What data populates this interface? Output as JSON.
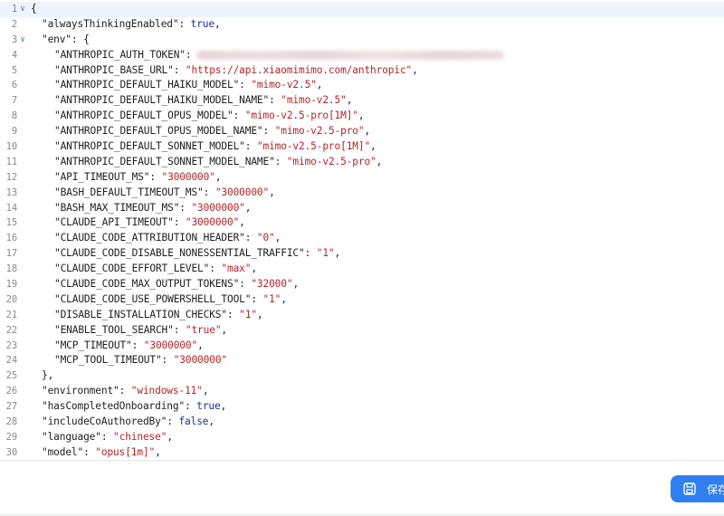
{
  "editor": {
    "lines": [
      {
        "n": "1",
        "fold": "∨",
        "indent": 0,
        "parts": [
          {
            "t": "{",
            "c": "p"
          }
        ]
      },
      {
        "n": "2",
        "fold": "",
        "indent": 1,
        "parts": [
          {
            "t": "\"alwaysThinkingEnabled\"",
            "c": "k"
          },
          {
            "t": ": ",
            "c": "p"
          },
          {
            "t": "true",
            "c": "b"
          },
          {
            "t": ",",
            "c": "p"
          }
        ]
      },
      {
        "n": "3",
        "fold": "∨",
        "indent": 1,
        "parts": [
          {
            "t": "\"env\"",
            "c": "k"
          },
          {
            "t": ": {",
            "c": "p"
          }
        ]
      },
      {
        "n": "4",
        "fold": "",
        "indent": 2,
        "redacted": true,
        "parts": [
          {
            "t": "\"ANTHROPIC_AUTH_TOKEN\"",
            "c": "k"
          },
          {
            "t": ":",
            "c": "p"
          }
        ]
      },
      {
        "n": "5",
        "fold": "",
        "indent": 2,
        "parts": [
          {
            "t": "\"ANTHROPIC_BASE_URL\"",
            "c": "k"
          },
          {
            "t": ": ",
            "c": "p"
          },
          {
            "t": "\"https://api.xiaomimimo.com/anthropic\"",
            "c": "s"
          },
          {
            "t": ",",
            "c": "p"
          }
        ]
      },
      {
        "n": "6",
        "fold": "",
        "indent": 2,
        "parts": [
          {
            "t": "\"ANTHROPIC_DEFAULT_HAIKU_MODEL\"",
            "c": "k"
          },
          {
            "t": ": ",
            "c": "p"
          },
          {
            "t": "\"mimo-v2.5\"",
            "c": "s"
          },
          {
            "t": ",",
            "c": "p"
          }
        ]
      },
      {
        "n": "7",
        "fold": "",
        "indent": 2,
        "parts": [
          {
            "t": "\"ANTHROPIC_DEFAULT_HAIKU_MODEL_NAME\"",
            "c": "k"
          },
          {
            "t": ": ",
            "c": "p"
          },
          {
            "t": "\"mimo-v2.5\"",
            "c": "s"
          },
          {
            "t": ",",
            "c": "p"
          }
        ]
      },
      {
        "n": "8",
        "fold": "",
        "indent": 2,
        "parts": [
          {
            "t": "\"ANTHROPIC_DEFAULT_OPUS_MODEL\"",
            "c": "k"
          },
          {
            "t": ": ",
            "c": "p"
          },
          {
            "t": "\"mimo-v2.5-pro[1M]\"",
            "c": "s"
          },
          {
            "t": ",",
            "c": "p"
          }
        ]
      },
      {
        "n": "9",
        "fold": "",
        "indent": 2,
        "parts": [
          {
            "t": "\"ANTHROPIC_DEFAULT_OPUS_MODEL_NAME\"",
            "c": "k"
          },
          {
            "t": ": ",
            "c": "p"
          },
          {
            "t": "\"mimo-v2.5-pro\"",
            "c": "s"
          },
          {
            "t": ",",
            "c": "p"
          }
        ]
      },
      {
        "n": "10",
        "fold": "",
        "indent": 2,
        "parts": [
          {
            "t": "\"ANTHROPIC_DEFAULT_SONNET_MODEL\"",
            "c": "k"
          },
          {
            "t": ": ",
            "c": "p"
          },
          {
            "t": "\"mimo-v2.5-pro[1M]\"",
            "c": "s"
          },
          {
            "t": ",",
            "c": "p"
          }
        ]
      },
      {
        "n": "11",
        "fold": "",
        "indent": 2,
        "parts": [
          {
            "t": "\"ANTHROPIC_DEFAULT_SONNET_MODEL_NAME\"",
            "c": "k"
          },
          {
            "t": ": ",
            "c": "p"
          },
          {
            "t": "\"mimo-v2.5-pro\"",
            "c": "s"
          },
          {
            "t": ",",
            "c": "p"
          }
        ]
      },
      {
        "n": "12",
        "fold": "",
        "indent": 2,
        "parts": [
          {
            "t": "\"API_TIMEOUT_MS\"",
            "c": "k"
          },
          {
            "t": ": ",
            "c": "p"
          },
          {
            "t": "\"3000000\"",
            "c": "s"
          },
          {
            "t": ",",
            "c": "p"
          }
        ]
      },
      {
        "n": "13",
        "fold": "",
        "indent": 2,
        "parts": [
          {
            "t": "\"BASH_DEFAULT_TIMEOUT_MS\"",
            "c": "k"
          },
          {
            "t": ": ",
            "c": "p"
          },
          {
            "t": "\"3000000\"",
            "c": "s"
          },
          {
            "t": ",",
            "c": "p"
          }
        ]
      },
      {
        "n": "14",
        "fold": "",
        "indent": 2,
        "parts": [
          {
            "t": "\"BASH_MAX_TIMEOUT_MS\"",
            "c": "k"
          },
          {
            "t": ": ",
            "c": "p"
          },
          {
            "t": "\"3000000\"",
            "c": "s"
          },
          {
            "t": ",",
            "c": "p"
          }
        ]
      },
      {
        "n": "15",
        "fold": "",
        "indent": 2,
        "parts": [
          {
            "t": "\"CLAUDE_API_TIMEOUT\"",
            "c": "k"
          },
          {
            "t": ": ",
            "c": "p"
          },
          {
            "t": "\"3000000\"",
            "c": "s"
          },
          {
            "t": ",",
            "c": "p"
          }
        ]
      },
      {
        "n": "16",
        "fold": "",
        "indent": 2,
        "parts": [
          {
            "t": "\"CLAUDE_CODE_ATTRIBUTION_HEADER\"",
            "c": "k"
          },
          {
            "t": ": ",
            "c": "p"
          },
          {
            "t": "\"0\"",
            "c": "s"
          },
          {
            "t": ",",
            "c": "p"
          }
        ]
      },
      {
        "n": "17",
        "fold": "",
        "indent": 2,
        "parts": [
          {
            "t": "\"CLAUDE_CODE_DISABLE_NONESSENTIAL_TRAFFIC\"",
            "c": "k"
          },
          {
            "t": ": ",
            "c": "p"
          },
          {
            "t": "\"1\"",
            "c": "s"
          },
          {
            "t": ",",
            "c": "p"
          }
        ]
      },
      {
        "n": "18",
        "fold": "",
        "indent": 2,
        "parts": [
          {
            "t": "\"CLAUDE_CODE_EFFORT_LEVEL\"",
            "c": "k"
          },
          {
            "t": ": ",
            "c": "p"
          },
          {
            "t": "\"max\"",
            "c": "s"
          },
          {
            "t": ",",
            "c": "p"
          }
        ]
      },
      {
        "n": "19",
        "fold": "",
        "indent": 2,
        "parts": [
          {
            "t": "\"CLAUDE_CODE_MAX_OUTPUT_TOKENS\"",
            "c": "k"
          },
          {
            "t": ": ",
            "c": "p"
          },
          {
            "t": "\"32000\"",
            "c": "s"
          },
          {
            "t": ",",
            "c": "p"
          }
        ]
      },
      {
        "n": "20",
        "fold": "",
        "indent": 2,
        "parts": [
          {
            "t": "\"CLAUDE_CODE_USE_POWERSHELL_TOOL\"",
            "c": "k"
          },
          {
            "t": ": ",
            "c": "p"
          },
          {
            "t": "\"1\"",
            "c": "s"
          },
          {
            "t": ",",
            "c": "p"
          }
        ]
      },
      {
        "n": "21",
        "fold": "",
        "indent": 2,
        "parts": [
          {
            "t": "\"DISABLE_INSTALLATION_CHECKS\"",
            "c": "k"
          },
          {
            "t": ": ",
            "c": "p"
          },
          {
            "t": "\"1\"",
            "c": "s"
          },
          {
            "t": ",",
            "c": "p"
          }
        ]
      },
      {
        "n": "22",
        "fold": "",
        "indent": 2,
        "parts": [
          {
            "t": "\"ENABLE_TOOL_SEARCH\"",
            "c": "k"
          },
          {
            "t": ": ",
            "c": "p"
          },
          {
            "t": "\"true\"",
            "c": "s"
          },
          {
            "t": ",",
            "c": "p"
          }
        ]
      },
      {
        "n": "23",
        "fold": "",
        "indent": 2,
        "parts": [
          {
            "t": "\"MCP_TIMEOUT\"",
            "c": "k"
          },
          {
            "t": ": ",
            "c": "p"
          },
          {
            "t": "\"3000000\"",
            "c": "s"
          },
          {
            "t": ",",
            "c": "p"
          }
        ]
      },
      {
        "n": "24",
        "fold": "",
        "indent": 2,
        "parts": [
          {
            "t": "\"MCP_TOOL_TIMEOUT\"",
            "c": "k"
          },
          {
            "t": ": ",
            "c": "p"
          },
          {
            "t": "\"3000000\"",
            "c": "s"
          }
        ]
      },
      {
        "n": "25",
        "fold": "",
        "indent": 1,
        "parts": [
          {
            "t": "},",
            "c": "p"
          }
        ]
      },
      {
        "n": "26",
        "fold": "",
        "indent": 1,
        "parts": [
          {
            "t": "\"environment\"",
            "c": "k"
          },
          {
            "t": ": ",
            "c": "p"
          },
          {
            "t": "\"windows-11\"",
            "c": "s"
          },
          {
            "t": ",",
            "c": "p"
          }
        ]
      },
      {
        "n": "27",
        "fold": "",
        "indent": 1,
        "parts": [
          {
            "t": "\"hasCompletedOnboarding\"",
            "c": "k"
          },
          {
            "t": ": ",
            "c": "p"
          },
          {
            "t": "true",
            "c": "b"
          },
          {
            "t": ",",
            "c": "p"
          }
        ]
      },
      {
        "n": "28",
        "fold": "",
        "indent": 1,
        "parts": [
          {
            "t": "\"includeCoAuthoredBy\"",
            "c": "k"
          },
          {
            "t": ": ",
            "c": "p"
          },
          {
            "t": "false",
            "c": "b"
          },
          {
            "t": ",",
            "c": "p"
          }
        ]
      },
      {
        "n": "29",
        "fold": "",
        "indent": 1,
        "parts": [
          {
            "t": "\"language\"",
            "c": "k"
          },
          {
            "t": ": ",
            "c": "p"
          },
          {
            "t": "\"chinese\"",
            "c": "s"
          },
          {
            "t": ",",
            "c": "p"
          }
        ]
      },
      {
        "n": "30",
        "fold": "",
        "indent": 1,
        "parts": [
          {
            "t": "\"model\"",
            "c": "k"
          },
          {
            "t": ": ",
            "c": "p"
          },
          {
            "t": "\"opus[1m]\"",
            "c": "s"
          },
          {
            "t": ",",
            "c": "p"
          }
        ]
      }
    ]
  },
  "footer": {
    "save_label": "保存",
    "save_icon": "save-icon",
    "accent": "#2f7ff0"
  }
}
